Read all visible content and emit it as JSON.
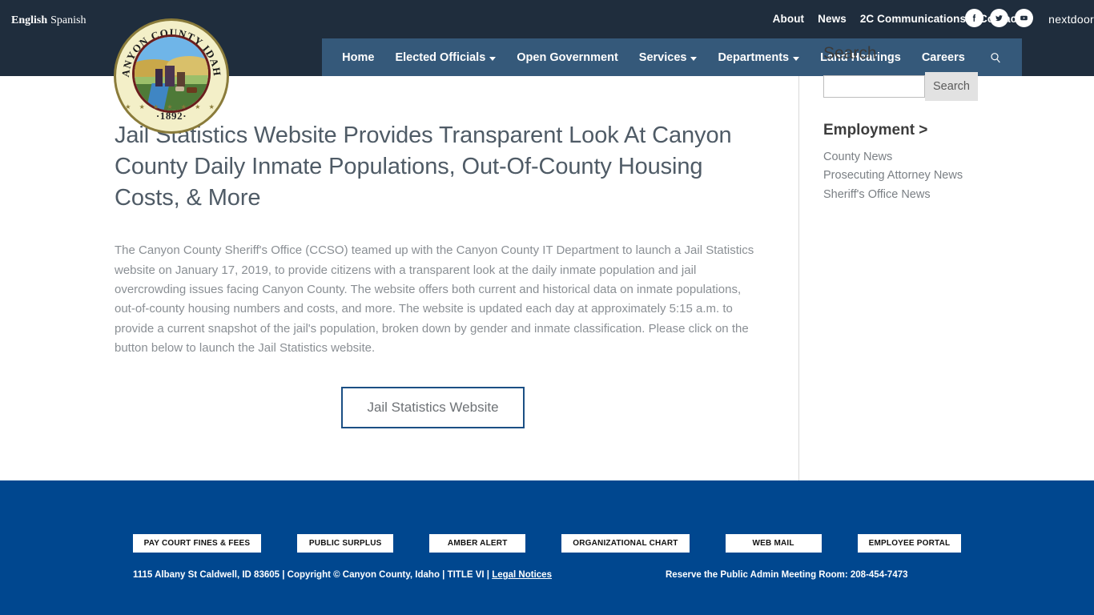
{
  "colors": {
    "header_dark": "#1f2d3d",
    "nav_slate": "#35597a",
    "footer_blue": "#00478f",
    "cta_border": "#1b4f84",
    "body_text": "#8a8f94",
    "heading_text": "#4f5b66"
  },
  "translate": {
    "english": "English",
    "spanish": "Spanish"
  },
  "utility_nav": [
    {
      "label": "About"
    },
    {
      "label": "News"
    },
    {
      "label": "2C Communications"
    },
    {
      "label": "Contact"
    }
  ],
  "social": [
    {
      "name": "facebook-icon",
      "glyph": "f"
    },
    {
      "name": "twitter-icon",
      "glyph": "t"
    },
    {
      "name": "youtube-icon",
      "glyph": "y"
    }
  ],
  "nextdoor_label": "nextdoor",
  "main_nav": [
    {
      "label": "Home",
      "has_caret": false
    },
    {
      "label": "Elected Officials",
      "has_caret": true
    },
    {
      "label": "Open Government",
      "has_caret": false
    },
    {
      "label": "Services",
      "has_caret": true
    },
    {
      "label": "Departments",
      "has_caret": true
    },
    {
      "label": "Land Hearings",
      "has_caret": false
    },
    {
      "label": "Careers",
      "has_caret": false
    }
  ],
  "seal": {
    "arc_top": "CANYON COUNTY IDAHO",
    "year": "·1892·",
    "stars": "★ ★ ★ ★ ★ ★ ★"
  },
  "article": {
    "title": "Jail Statistics Website Provides Transparent Look At Canyon County Daily Inmate Populations, Out-Of-County Housing Costs, & More",
    "body": "The Canyon County Sheriff's Office (CCSO) teamed up with the Canyon County IT Department to launch a Jail Statistics website on January 17, 2019, to provide citizens with a transparent look at the daily inmate population and jail overcrowding issues facing Canyon County.  The website offers both current and historical data on inmate populations, out-of-county housing numbers and costs, and more.  The website is updated each day at approximately 5:15 a.m. to provide a current snapshot of the jail's population, broken down by gender and inmate classification.  Please click on the button below to launch the Jail Statistics website.",
    "cta_label": "Jail Statistics Website"
  },
  "sidebar": {
    "search_heading": "Search",
    "search_value": "",
    "search_placeholder": "",
    "search_button": "Search",
    "employment_heading": "Employment >",
    "links": [
      {
        "label": "County News"
      },
      {
        "label": "Prosecuting Attorney News"
      },
      {
        "label": "Sheriff's Office News"
      }
    ]
  },
  "footer": {
    "buttons": [
      {
        "label": "PAY COURT FINES & FEES"
      },
      {
        "label": "PUBLIC SURPLUS"
      },
      {
        "label": "AMBER ALERT"
      },
      {
        "label": "ORGANIZATIONAL CHART"
      },
      {
        "label": "WEB MAIL"
      },
      {
        "label": "EMPLOYEE PORTAL"
      }
    ],
    "legal_text": "1115 Albany St Caldwell, ID 83605 | Copyright © Canyon County, Idaho | TITLE VI | ",
    "legal_link": "Legal Notices",
    "reserve_text": "Reserve the Public Admin Meeting Room: 208-454-7473"
  }
}
